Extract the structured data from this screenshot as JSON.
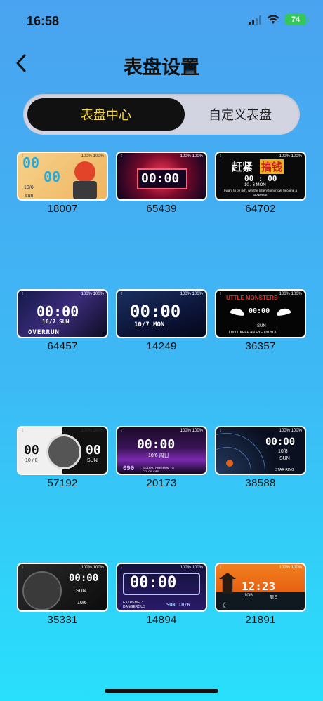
{
  "status_bar": {
    "time": "16:58",
    "battery": "74"
  },
  "header": {
    "title": "表盘设置"
  },
  "tabs": [
    {
      "label": "表盘中心",
      "active": true
    },
    {
      "label": "自定义表盘",
      "active": false
    }
  ],
  "faces": [
    {
      "id": "18007",
      "t1": "00",
      "t2": "00",
      "t3": "10/6",
      "t4": "sun",
      "icon": "bluetooth-icon"
    },
    {
      "id": "65439",
      "t1": "00:00",
      "icon": "bluetooth-icon"
    },
    {
      "id": "64702",
      "t1": "赶紧",
      "t2": "搞钱",
      "t3": "00 : 00",
      "t4": "10 / 6      MON",
      "t5": "I want to be rich, win the lottery tomorrow, become a top person",
      "icon": "bluetooth-icon"
    },
    {
      "id": "64457",
      "t1": "00:00",
      "t2": "10/7   SUN",
      "t3": "OVERRUN",
      "icon": "bluetooth-icon"
    },
    {
      "id": "14249",
      "t1": "00:00",
      "t2": "10/7   MON",
      "icon": "bluetooth-icon"
    },
    {
      "id": "36357",
      "t1": "UTTLE MONSTERS",
      "t2": "00:00",
      "t3": "SUN",
      "t4": "I WILL KEEP AN EYE ON YOU",
      "icon": "bluetooth-icon"
    },
    {
      "id": "57192",
      "t1": "00",
      "t2": "10 / 0",
      "t3": "00",
      "t4": "SUN",
      "icon": "bluetooth-icon"
    },
    {
      "id": "20173",
      "t1": "00:00",
      "t2": "10/6   周日",
      "t3": "090",
      "t4": "SEA AND FREEDOM TO COLOR LIFE",
      "icon": "bluetooth-icon"
    },
    {
      "id": "38588",
      "t1": "00:00",
      "t2": "10/8",
      "t3": "SUN",
      "t4": "STAR RING",
      "icon": "bluetooth-icon"
    },
    {
      "id": "35331",
      "t1": "00:00",
      "t2": "SUN",
      "t3": "10/6",
      "icon": "bluetooth-icon"
    },
    {
      "id": "14894",
      "t1": "00:00",
      "t2": "EXTREMELY DANGEROUS",
      "t3": "SUN 10/6",
      "icon": "bluetooth-icon"
    },
    {
      "id": "21891",
      "t1": "12:23",
      "t2": "10/6",
      "t3": "周日",
      "icon": "bluetooth-icon"
    }
  ],
  "thumb_status": {
    "steps": "100%",
    "heart": "100%"
  },
  "colors": {
    "accent": "#f5d94a",
    "tab_active_bg": "#111111",
    "battery": "#34c759"
  }
}
